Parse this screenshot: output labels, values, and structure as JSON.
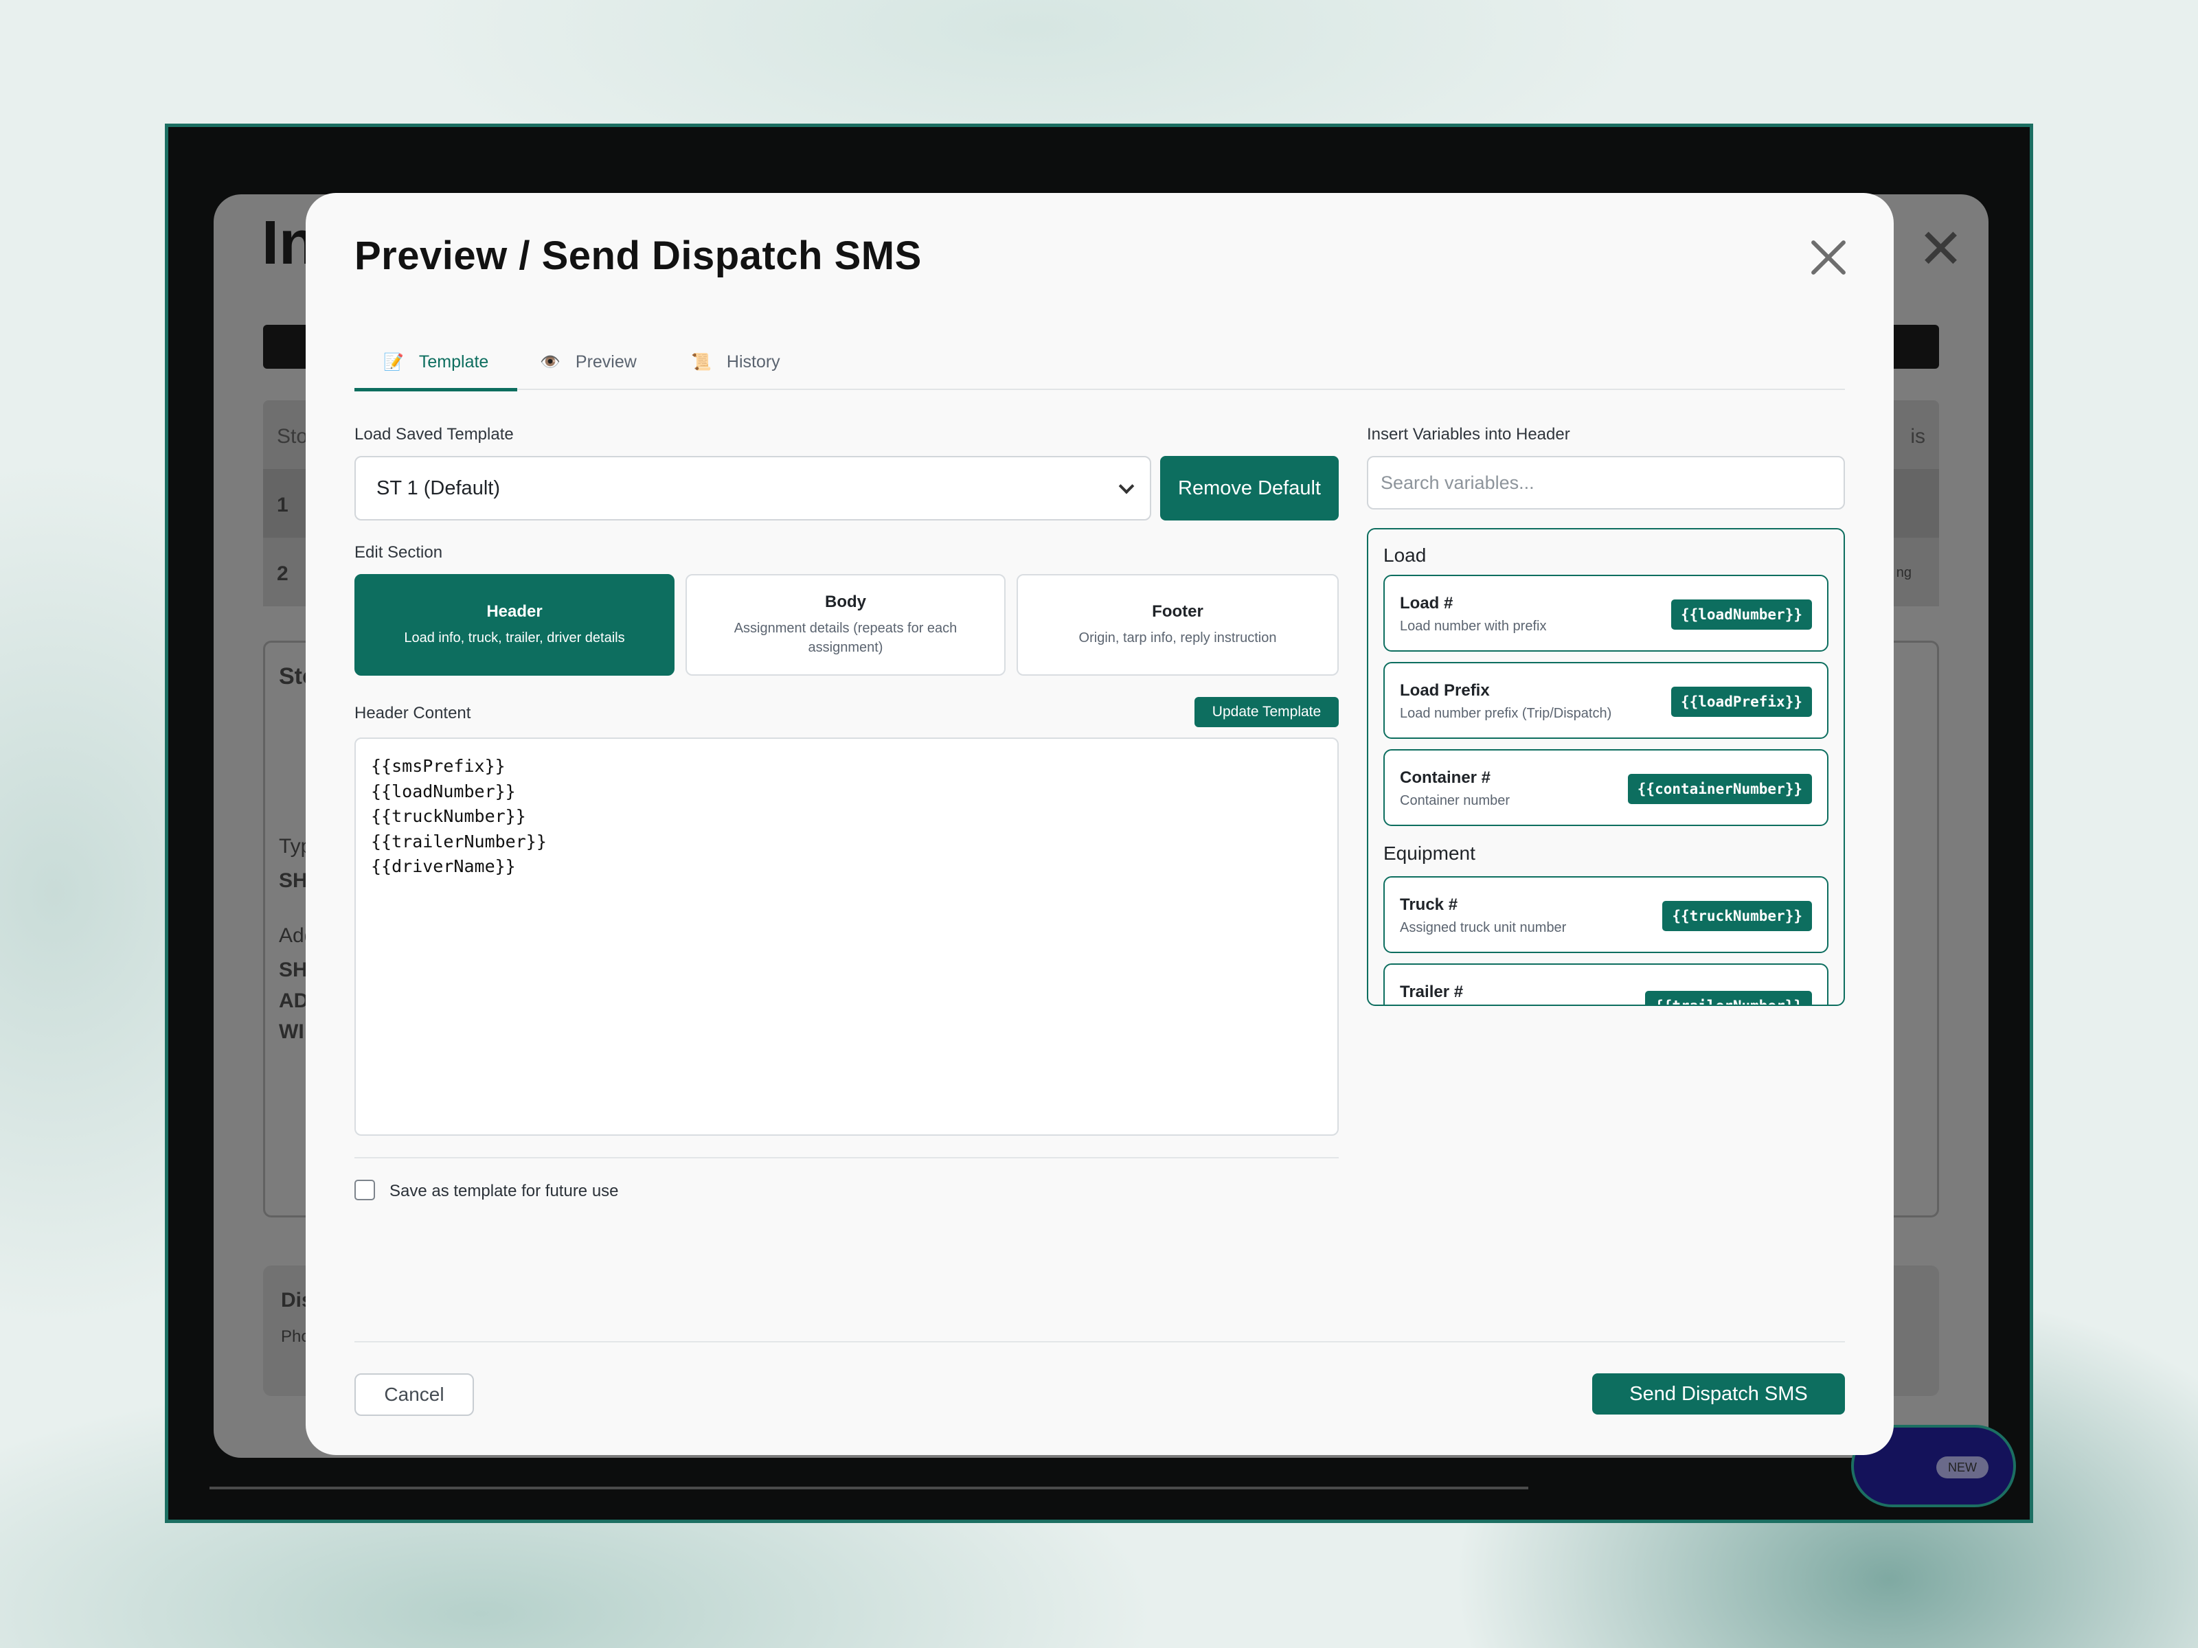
{
  "background_app": {
    "title": "In",
    "stops_header": "Sto",
    "row1": "1",
    "row2": "2",
    "col_status": "is",
    "row2_badge": "ng",
    "stop_card_title": "Sto",
    "type_label": "Typ",
    "type_value": "SH",
    "addr_label": "Add",
    "addr_line1": "SH",
    "addr_line2": "AD",
    "addr_line3": "WI",
    "dispatch_label": "Dis",
    "phone_label": "Pho",
    "new_badge": "NEW"
  },
  "modal": {
    "title": "Preview / Send Dispatch SMS",
    "tabs": [
      {
        "label": "Template",
        "icon": "📝",
        "active": true
      },
      {
        "label": "Preview",
        "icon": "👁️",
        "active": false
      },
      {
        "label": "History",
        "icon": "📜",
        "active": false
      }
    ],
    "load_template_label": "Load Saved Template",
    "template_selected": "ST 1 (Default)",
    "remove_default_label": "Remove Default",
    "edit_section_label": "Edit Section",
    "sections": [
      {
        "title": "Header",
        "desc": "Load info, truck, trailer, driver details",
        "active": true
      },
      {
        "title": "Body",
        "desc": "Assignment details (repeats for each assignment)",
        "active": false
      },
      {
        "title": "Footer",
        "desc": "Origin, tarp info, reply instruction",
        "active": false
      }
    ],
    "content_label": "Header Content",
    "update_template_label": "Update Template",
    "content_value": "{{smsPrefix}}\n{{loadNumber}}\n{{truckNumber}}\n{{trailerNumber}}\n{{driverName}}",
    "save_template_label": "Save as template for future use",
    "save_template_checked": false,
    "variables_label": "Insert Variables into Header",
    "search_placeholder": "Search variables...",
    "variable_groups": [
      {
        "name": "Load",
        "items": [
          {
            "name": "Load #",
            "desc": "Load number with prefix",
            "token": "{{loadNumber}}"
          },
          {
            "name": "Load Prefix",
            "desc": "Load number prefix (Trip/Dispatch)",
            "token": "{{loadPrefix}}"
          },
          {
            "name": "Container #",
            "desc": "Container number",
            "token": "{{containerNumber}}"
          }
        ]
      },
      {
        "name": "Equipment",
        "items": [
          {
            "name": "Truck #",
            "desc": "Assigned truck unit number",
            "token": "{{truckNumber}}"
          },
          {
            "name": "Trailer #",
            "desc": "",
            "token": "{{trailerNumber}}"
          }
        ]
      }
    ],
    "cancel_label": "Cancel",
    "send_label": "Send Dispatch SMS",
    "accent_color": "#0d6e5f"
  }
}
